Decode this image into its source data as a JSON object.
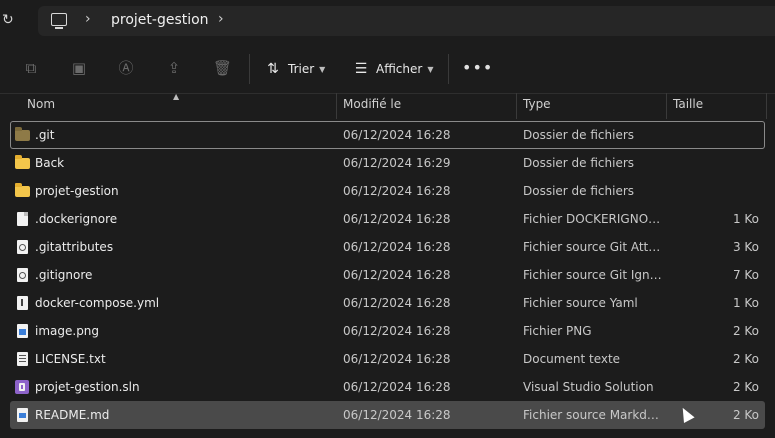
{
  "address": {
    "breadcrumb": "projet-gestion"
  },
  "toolbar": {
    "sort_label": "Trier",
    "view_label": "Afficher"
  },
  "columns": {
    "name": "Nom",
    "modified": "Modifié le",
    "type": "Type",
    "size": "Taille"
  },
  "files": [
    {
      "name": ".git",
      "modified": "06/12/2024 16:28",
      "type": "Dossier de fichiers",
      "size": "",
      "icon": "folder-icon"
    },
    {
      "name": "Back",
      "modified": "06/12/2024 16:29",
      "type": "Dossier de fichiers",
      "size": "",
      "icon": "folder-icon"
    },
    {
      "name": "projet-gestion",
      "modified": "06/12/2024 16:28",
      "type": "Dossier de fichiers",
      "size": "",
      "icon": "folder-icon"
    },
    {
      "name": ".dockerignore",
      "modified": "06/12/2024 16:28",
      "type": "Fichier DOCKERIGNORE",
      "size": "1 Ko",
      "icon": "file-icon"
    },
    {
      "name": ".gitattributes",
      "modified": "06/12/2024 16:28",
      "type": "Fichier source Git Attrib...",
      "size": "3 Ko",
      "icon": "config-file-icon"
    },
    {
      "name": ".gitignore",
      "modified": "06/12/2024 16:28",
      "type": "Fichier source Git Ignore",
      "size": "7 Ko",
      "icon": "config-file-icon"
    },
    {
      "name": "docker-compose.yml",
      "modified": "06/12/2024 16:28",
      "type": "Fichier source Yaml",
      "size": "1 Ko",
      "icon": "yaml-file-icon"
    },
    {
      "name": "image.png",
      "modified": "06/12/2024 16:28",
      "type": "Fichier PNG",
      "size": "2 Ko",
      "icon": "image-file-icon"
    },
    {
      "name": "LICENSE.txt",
      "modified": "06/12/2024 16:28",
      "type": "Document texte",
      "size": "2 Ko",
      "icon": "text-file-icon"
    },
    {
      "name": "projet-gestion.sln",
      "modified": "06/12/2024 16:28",
      "type": "Visual Studio Solution",
      "size": "2 Ko",
      "icon": "visual-studio-icon"
    },
    {
      "name": "README.md",
      "modified": "06/12/2024 16:28",
      "type": "Fichier source Markdown",
      "size": "2 Ko",
      "icon": "markdown-file-icon"
    }
  ],
  "colors": {
    "background": "#1c1c1c",
    "folder": "#f3c64b",
    "hover_row": "#4a4a4a"
  }
}
